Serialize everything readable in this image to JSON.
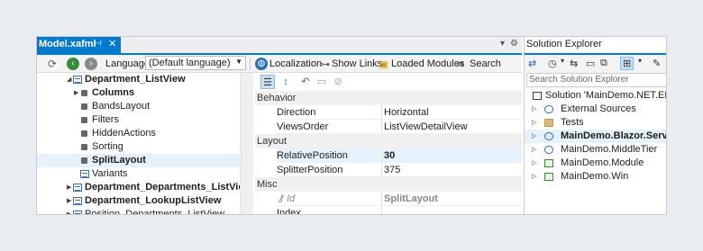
{
  "editor": {
    "tab_title": "Model.xafml",
    "tab_pin": "⊣",
    "tab_close": "✕",
    "tab_dropdown": "▾",
    "tab_gear": "⚙"
  },
  "toolbar": {
    "language_label": "Language",
    "language_value": "(Default language)",
    "localization": "Localization",
    "show_links": "Show Links",
    "loaded_modules": "Loaded Modules",
    "search": "Search"
  },
  "tree": {
    "items": [
      {
        "label": "Department_ListView",
        "bold": true
      },
      {
        "label": "Columns",
        "bold": true
      },
      {
        "label": "BandsLayout",
        "bold": false
      },
      {
        "label": "Filters",
        "bold": false
      },
      {
        "label": "HiddenActions",
        "bold": false
      },
      {
        "label": "Sorting",
        "bold": false
      },
      {
        "label": "SplitLayout",
        "bold": true
      },
      {
        "label": "Variants",
        "bold": false
      },
      {
        "label": "Department_Departments_ListView",
        "bold": true
      },
      {
        "label": "Department_LookupListView",
        "bold": true
      },
      {
        "label": "Position_Departments_ListView",
        "bold": false
      }
    ]
  },
  "properties": {
    "categories": [
      "Behavior",
      "Layout",
      "Misc"
    ],
    "behavior": [
      {
        "name": "Direction",
        "value": "Horizontal"
      },
      {
        "name": "ViewsOrder",
        "value": "ListViewDetailView"
      }
    ],
    "layout": [
      {
        "name": "RelativePosition",
        "value": "30"
      },
      {
        "name": "SplitterPosition",
        "value": "375"
      }
    ],
    "misc": [
      {
        "name": "Id",
        "value": "SplitLayout"
      },
      {
        "name": "Index",
        "value": ""
      }
    ]
  },
  "solution_explorer": {
    "title": "Solution Explorer",
    "search_placeholder": "Search Solution Explorer",
    "items": [
      {
        "label": "Solution 'MainDemo.NET.EFCore"
      },
      {
        "label": "External Sources"
      },
      {
        "label": "Tests"
      },
      {
        "label": "MainDemo.Blazor.Server"
      },
      {
        "label": "MainDemo.MiddleTier"
      },
      {
        "label": "MainDemo.Module"
      },
      {
        "label": "MainDemo.Win"
      }
    ]
  },
  "colors": {
    "accent": "#007acc",
    "selection": "#e5f1fb"
  }
}
